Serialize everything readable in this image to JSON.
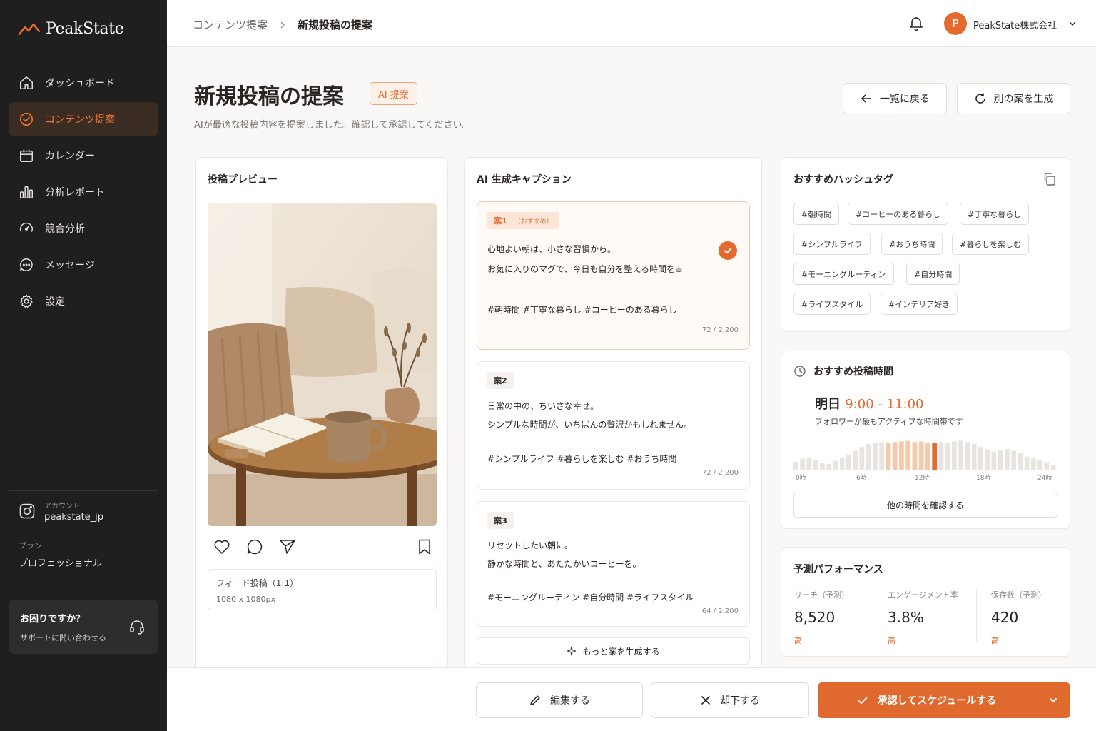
{
  "brand": {
    "name": "PeakState",
    "accent": "#e46a2e"
  },
  "sidebar": {
    "items": [
      {
        "label": "ダッシュボード",
        "icon": "home-icon",
        "active": false
      },
      {
        "label": "コンテンツ提案",
        "icon": "check-circle-icon",
        "active": true
      },
      {
        "label": "カレンダー",
        "icon": "calendar-icon",
        "active": false
      },
      {
        "label": "分析レポート",
        "icon": "bar-chart-icon",
        "active": false
      },
      {
        "label": "競合分析",
        "icon": "gauge-icon",
        "active": false
      },
      {
        "label": "メッセージ",
        "icon": "chat-icon",
        "active": false
      },
      {
        "label": "設定",
        "icon": "gear-icon",
        "active": false
      }
    ],
    "account_label": "アカウント",
    "account_name": "peakstate_jp",
    "plan_label": "プラン",
    "plan_name": "プロフェッショナル",
    "help_title": "お困りですか？",
    "help_link": "サポートに問い合わせる"
  },
  "topbar": {
    "breadcrumb_parent": "コンテンツ提案",
    "breadcrumb_current": "新規投稿の提案",
    "avatar_letter": "P",
    "company": "PeakState株式会社"
  },
  "header": {
    "title": "新規投稿の提案",
    "badge": "AI 提案",
    "subtitle": "AIが最適な投稿内容を提案しました。確認して承認してください。",
    "back_button": "一覧に戻る",
    "regenerate_button": "別の案を生成"
  },
  "preview": {
    "title": "投稿プレビュー",
    "format": "フィード投稿（1:1）",
    "size": "1080 x 1080px"
  },
  "captions": {
    "title": "AI 生成キャプション",
    "items": [
      {
        "tag": "案1",
        "tag_note": "（おすすめ）",
        "line1": "心地よい朝は、小さな習慣から。",
        "line2": "お気に入りのマグで、今日も自分を整える時間を☕",
        "hashtags": "#朝時間 #丁寧な暮らし #コーヒーのある暮らし",
        "count": "72 / 2,200",
        "selected": true
      },
      {
        "tag": "案2",
        "tag_note": "",
        "line1": "日常の中の、ちいさな幸せ。",
        "line2": "シンプルな時間が、いちばんの贅沢かもしれません。",
        "hashtags": "#シンプルライフ #暮らしを楽しむ #おうち時間",
        "count": "72 / 2,200",
        "selected": false
      },
      {
        "tag": "案3",
        "tag_note": "",
        "line1": "リセットしたい朝に。",
        "line2": "静かな時間と、あたたかいコーヒーを。",
        "hashtags": "#モーニングルーティン #自分時間 #ライフスタイル",
        "count": "64 / 2,200",
        "selected": false
      }
    ],
    "more_button": "もっと案を生成する"
  },
  "hashtags": {
    "title": "おすすめハッシュタグ",
    "tags": [
      "#朝時間",
      "#コーヒーのある暮らし",
      "#丁寧な暮らし",
      "#シンプルライフ",
      "#おうち時間",
      "#暮らしを楽しむ",
      "#モーニングルーティン",
      "#自分時間",
      "#ライフスタイル",
      "#インテリア好き"
    ]
  },
  "best_time": {
    "title": "おすすめ投稿時間",
    "day": "明日",
    "range": "9:00 - 11:00",
    "note": "フォロワーが最もアクティブな時間帯です",
    "axis_labels": [
      "0時",
      "6時",
      "12時",
      "18時",
      "24時"
    ],
    "activity": [
      0.25,
      0.35,
      0.4,
      0.3,
      0.22,
      0.18,
      0.28,
      0.38,
      0.48,
      0.6,
      0.72,
      0.82,
      0.86,
      0.88,
      0.84,
      0.88,
      0.9,
      0.92,
      0.88,
      0.9,
      0.86,
      0.84,
      0.88,
      0.86,
      0.9,
      0.92,
      0.88,
      0.82,
      0.72,
      0.65,
      0.58,
      0.62,
      0.66,
      0.6,
      0.54,
      0.42,
      0.38,
      0.32,
      0.24,
      0.14
    ],
    "highlight_range": [
      14,
      21
    ],
    "peak_index": 21,
    "other_button": "他の時間を確認する"
  },
  "performance": {
    "title": "予測パフォーマンス",
    "metrics": [
      {
        "label": "リーチ（予測）",
        "value": "8,520",
        "level": "高"
      },
      {
        "label": "エンゲージメント率",
        "value": "3.8%",
        "level": "高"
      },
      {
        "label": "保存数（予測）",
        "value": "420",
        "level": "高"
      }
    ]
  },
  "actions": {
    "edit": "編集する",
    "reject": "却下する",
    "approve": "承認してスケジュールする"
  }
}
